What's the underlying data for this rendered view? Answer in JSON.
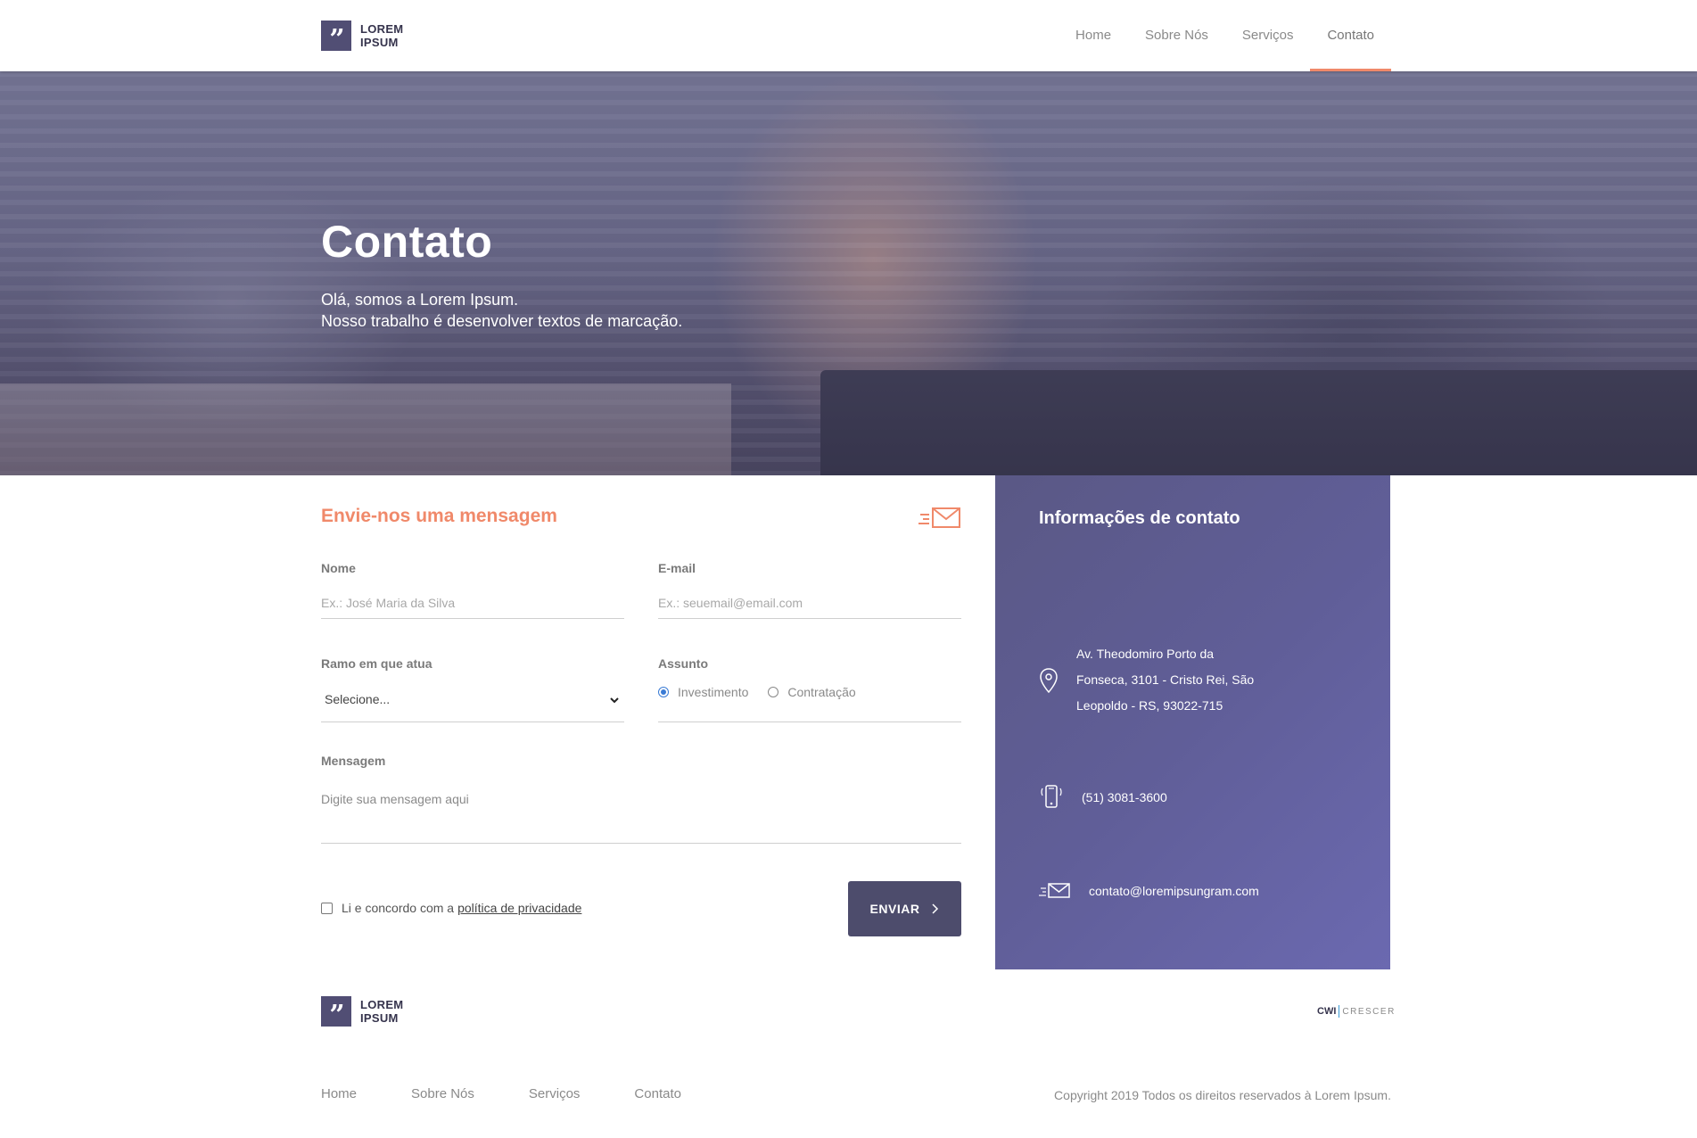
{
  "header": {
    "logo_line1": "LOREM",
    "logo_line2": "IPSUM",
    "nav": [
      {
        "label": "Home"
      },
      {
        "label": "Sobre Nós"
      },
      {
        "label": "Serviços"
      },
      {
        "label": "Contato",
        "active": true
      }
    ]
  },
  "hero": {
    "title": "Contato",
    "subtitle_line1": "Olá, somos a Lorem Ipsum.",
    "subtitle_line2": "Nosso trabalho é desenvolver textos de marcação."
  },
  "form": {
    "title": "Envie-nos uma mensagem",
    "name_label": "Nome",
    "name_placeholder": "Ex.: José Maria da Silva",
    "email_label": "E-mail",
    "email_placeholder": "Ex.: seuemail@email.com",
    "sector_label": "Ramo em que atua",
    "sector_value": "Selecione...",
    "subject_label": "Assunto",
    "subject_options": [
      {
        "label": "Investimento",
        "checked": true
      },
      {
        "label": "Contratação",
        "checked": false
      }
    ],
    "message_label": "Mensagem",
    "message_placeholder": "Digite sua mensagem aqui",
    "consent_text": "Li e concordo com a",
    "consent_link": "política de privacidade",
    "submit_label": "ENVIAR"
  },
  "contact_info": {
    "title": "Informações de contato",
    "address_line1": "Av. Theodomiro Porto da",
    "address_line2": "Fonseca, 3101 - Cristo Rei, São",
    "address_line3": "Leopoldo - RS, 93022-715",
    "phone": "(51) 3081-3600",
    "email": "contato@loremipsungram.com"
  },
  "footer": {
    "logo_line1": "LOREM",
    "logo_line2": "IPSUM",
    "partner_cwi": "CWI",
    "partner_crescer": "CRESCER",
    "nav": [
      {
        "label": "Home"
      },
      {
        "label": "Sobre Nós"
      },
      {
        "label": "Serviços"
      },
      {
        "label": "Contato"
      }
    ],
    "copyright": "Copyright 2019 Todos os direitos reservados à Lorem Ipsum."
  },
  "colors": {
    "accent": "#f0896a",
    "brand": "#514e74",
    "panel": "#605e98",
    "radio_selected": "#3a7bd5"
  }
}
